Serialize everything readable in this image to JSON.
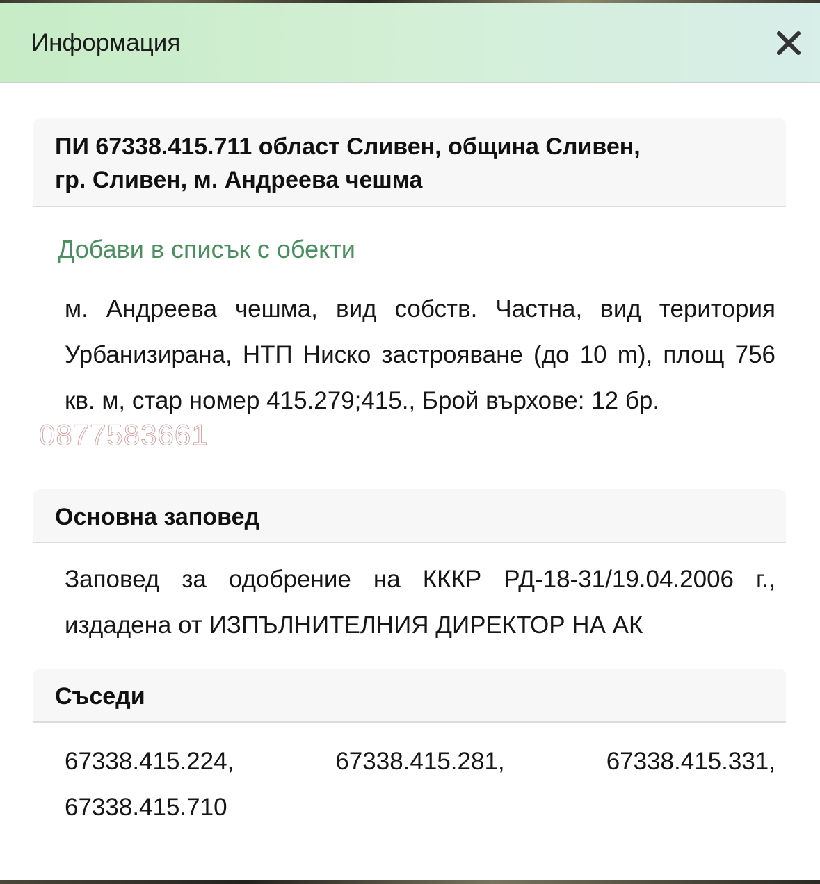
{
  "dialog": {
    "title": "Информация",
    "close_label": "×"
  },
  "parcel": {
    "heading_line1": "ПИ 67338.415.711 област Сливен, община Сливен,",
    "heading_line2": "гр. Сливен, м. Андреева чешма",
    "add_link": "Добави в списък с обекти",
    "description": "м. Андреева чешма, вид собств. Частна, вид територия Урбанизирана, НТП Ниско застрояване (до 10 m), площ 756 кв. м, стар номер 415.279;415., Брой върхове: 12 бр."
  },
  "watermark": "0877583661",
  "order": {
    "heading": "Основна заповед",
    "text": "Заповед за одобрение на КККР РД-18-31/19.04.2006 г., издадена от ИЗПЪЛНИТЕЛНИЯ ДИРЕКТОР НА АК"
  },
  "neighbors": {
    "heading": "Съседи",
    "items": [
      "67338.415.224,",
      "67338.415.281,",
      "67338.415.331,",
      "67338.415.710"
    ]
  }
}
